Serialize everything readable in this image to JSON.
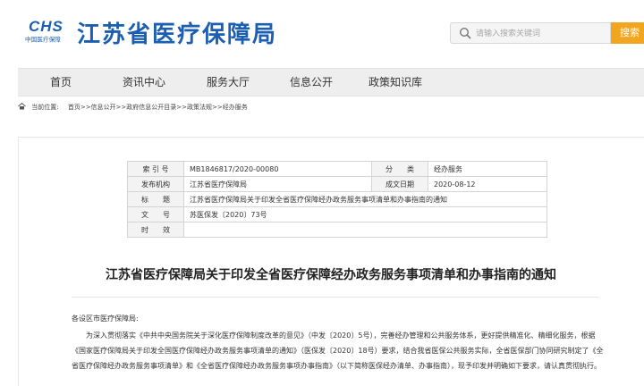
{
  "header": {
    "logo_mark": "CHS",
    "logo_sub": "中国医疗保障",
    "title": "江苏省医疗保障局",
    "search_placeholder": "请输入搜索关键词",
    "search_button": "搜索",
    "brand_color": "#1b5fb3",
    "accent_color": "#f2a51f"
  },
  "nav": {
    "items": [
      "首页",
      "资讯中心",
      "服务大厅",
      "信息公开",
      "政策知识库"
    ]
  },
  "breadcrumb": {
    "label": "当前位置:",
    "path": "首页>>信息公开>>政府信息公开目录>>政策法规>>经办服务"
  },
  "info_table": {
    "index_label": "索 引 号",
    "index_value": "MB1846817/2020-00080",
    "category_label": "分　　类",
    "category_value": "经办服务",
    "issuer_label": "发布机构",
    "issuer_value": "江苏省医疗保障局",
    "date_label": "成文日期",
    "date_value": "2020-08-12",
    "subject_label": "标　　题",
    "subject_value": "江苏省医疗保障局关于印发全省医疗保障经办政务服务事项清单和办事指南的通知",
    "docno_label": "文　　号",
    "docno_value": "苏医保发〔2020〕73号",
    "validity_label": "时　　效",
    "validity_value": ""
  },
  "document": {
    "title": "江苏省医疗保障局关于印发全省医疗保障经办政务服务事项清单和办事指南的通知",
    "salutation": "各设区市医疗保障局:",
    "paragraph": "为深入贯彻落实《中共中央国务院关于深化医疗保障制度改革的意见》（中发〔2020〕5号），完善经办管理和公共服务体系，更好提供精准化、精细化服务，根据《国家医疗保障局关于印发全国医疗保障经办政务服务事项清单的通知》（医保发〔2020〕18号）要求，结合我省医保公共服务实际，全省医保部门协同研究制定了《全省医疗保障经办政务服务事项清单》和《全省医疗保障经办政务服务事项办事指南》（以下简称医保经办清单、办事指南），现予印发并明确如下要求，请认真贯彻执行。"
  }
}
